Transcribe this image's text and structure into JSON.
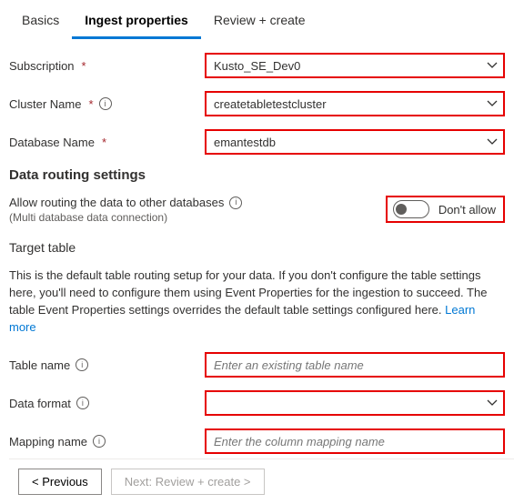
{
  "tabs": {
    "basics": "Basics",
    "ingest": "Ingest properties",
    "review": "Review + create"
  },
  "fields": {
    "subscription_label": "Subscription",
    "subscription_value": "Kusto_SE_Dev0",
    "cluster_label": "Cluster Name",
    "cluster_value": "createtabletestcluster",
    "database_label": "Database Name",
    "database_value": "emantestdb"
  },
  "routing": {
    "heading": "Data routing settings",
    "allow_line": "Allow routing the data to other databases",
    "allow_sub": "(Multi database data connection)",
    "toggle_label": "Don't allow"
  },
  "target": {
    "heading": "Target table",
    "description_main": "This is the default table routing setup for your data. If you don't configure the table settings here, you'll need to configure them using Event Properties for the ingestion to succeed. The table Event Properties settings overrides the default table settings configured here. ",
    "learn_more": "Learn more",
    "table_label": "Table name",
    "table_placeholder": "Enter an existing table name",
    "format_label": "Data format",
    "mapping_label": "Mapping name",
    "mapping_placeholder": "Enter the column mapping name"
  },
  "footer": {
    "prev": "< Previous",
    "next": "Next: Review + create >"
  }
}
